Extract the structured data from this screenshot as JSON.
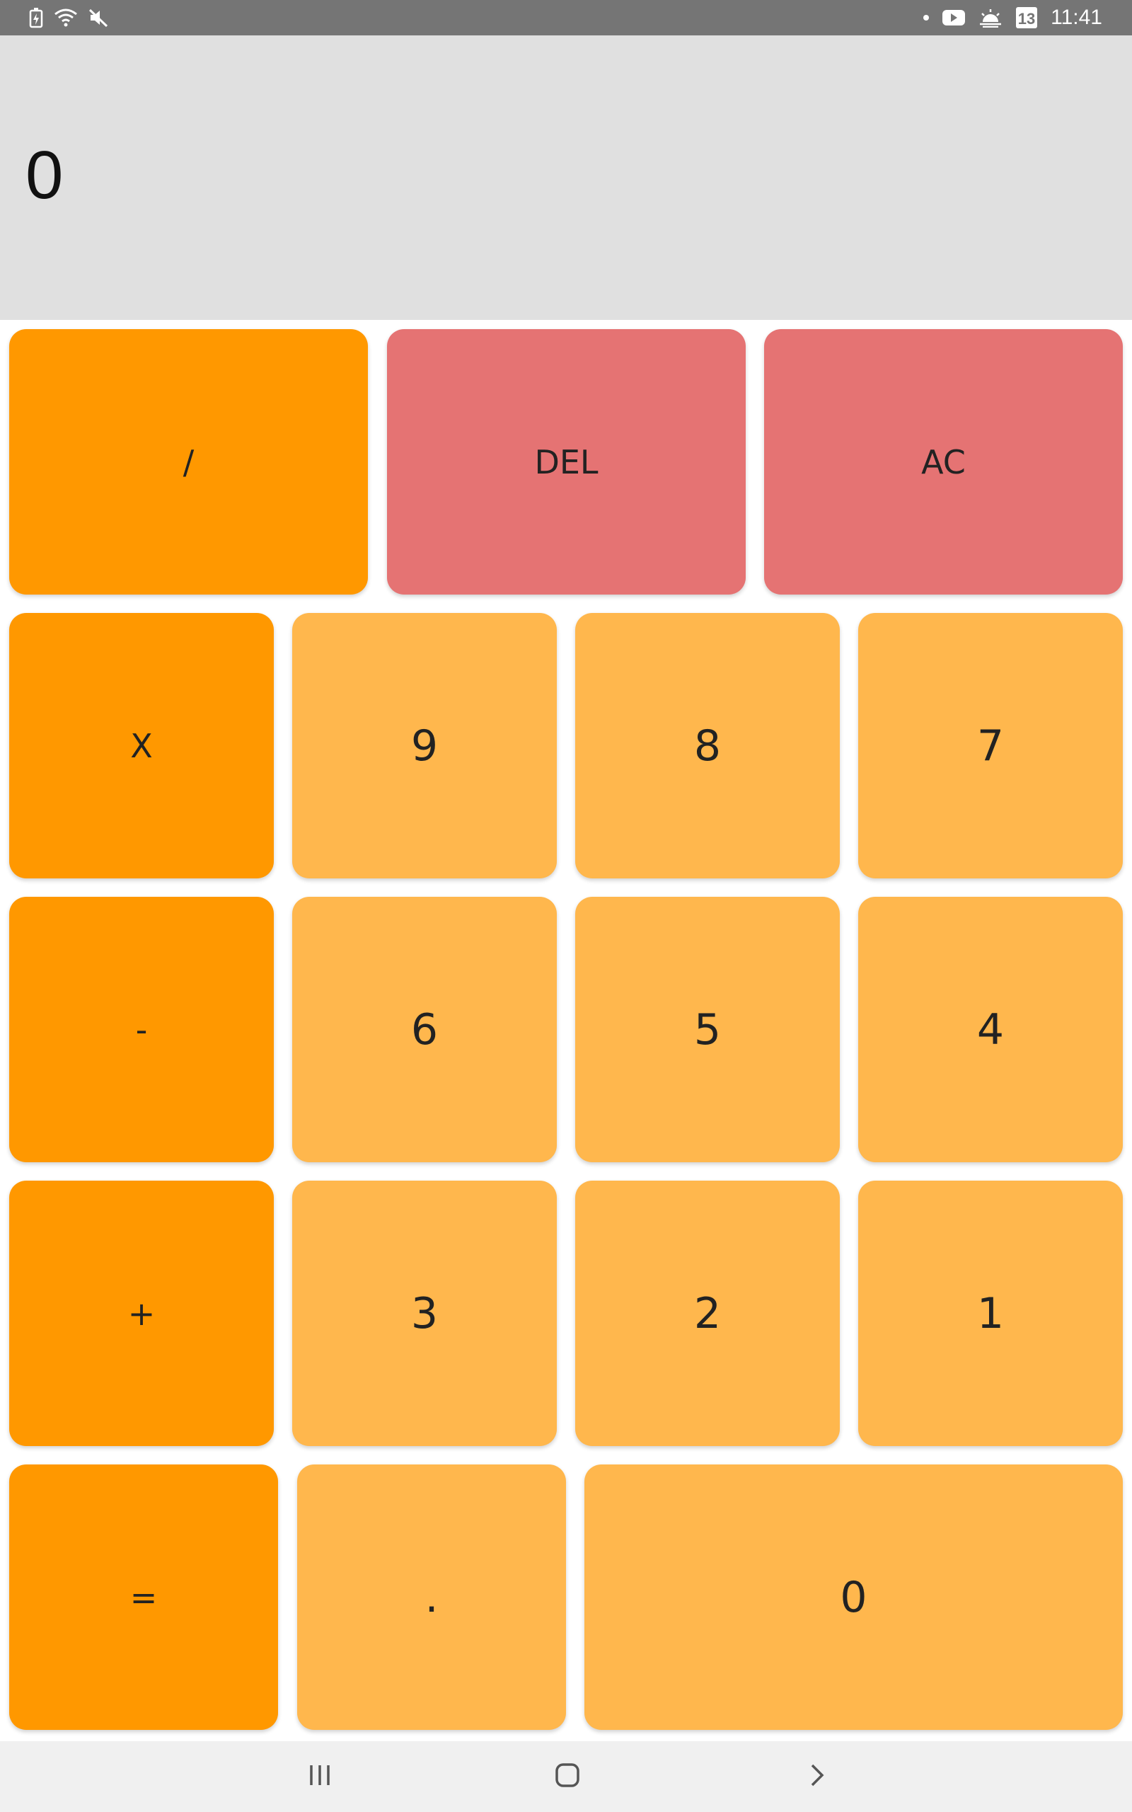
{
  "status_bar": {
    "time": "11:41",
    "left_icons": [
      "battery-saver-icon",
      "wifi-icon",
      "mute-icon"
    ],
    "right_icons": [
      "notification-dot-icon",
      "youtube-icon",
      "weather-icon",
      "calendar-13-icon"
    ],
    "calendar_day": "13"
  },
  "display": {
    "value": "0"
  },
  "keypad": {
    "rows": [
      [
        "/",
        "DEL",
        "AC"
      ],
      [
        "X",
        "9",
        "8",
        "7"
      ],
      [
        "-",
        "6",
        "5",
        "4"
      ],
      [
        "+",
        "3",
        "2",
        "1"
      ],
      [
        "=",
        ".",
        "0"
      ]
    ]
  },
  "colors": {
    "operator": "#ff9800",
    "number": "#ffb74d",
    "clear": "#e57373",
    "display_bg": "#e0e0e0",
    "status_bar": "#757575"
  },
  "nav_bar": {
    "icons": [
      "recent-apps-icon",
      "home-icon",
      "back-icon"
    ]
  }
}
